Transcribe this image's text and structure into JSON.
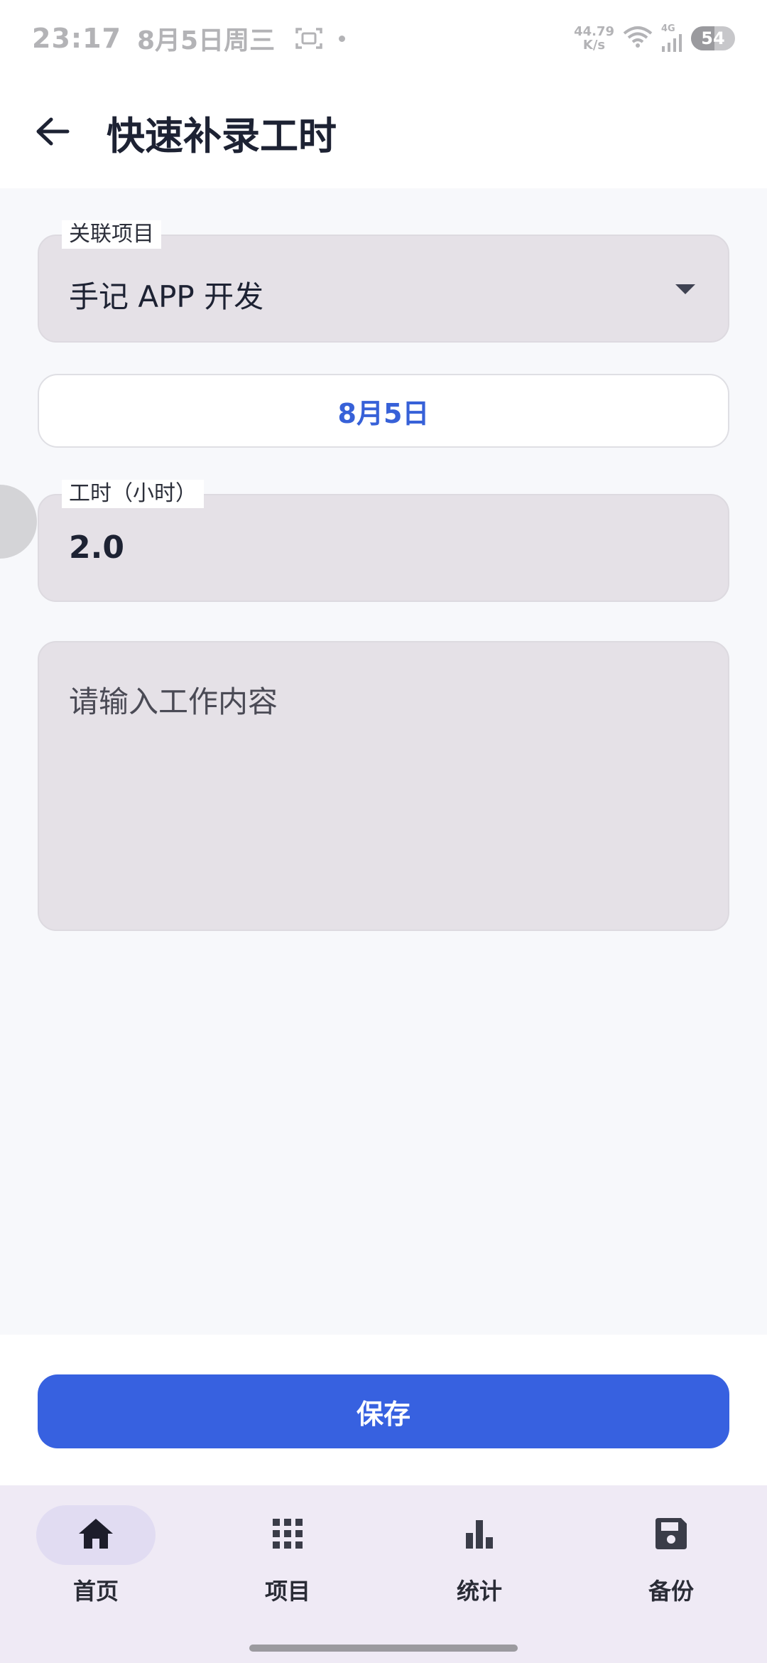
{
  "status_bar": {
    "time": "23:17",
    "date": "8月5日周三",
    "net_speed_value": "44.79",
    "net_speed_unit": "K/s",
    "network_type": "4G",
    "battery_level": "54"
  },
  "app_bar": {
    "title": "快速补录工时"
  },
  "form": {
    "project": {
      "label": "关联项目",
      "value": "手记 APP 开发"
    },
    "date": {
      "value": "8月5日"
    },
    "hours": {
      "label": "工时（小时）",
      "value": "2.0"
    },
    "content": {
      "placeholder": "请输入工作内容"
    }
  },
  "save_label": "保存",
  "bottom_nav": {
    "items": [
      {
        "label": "首页",
        "icon": "home-icon",
        "active": true
      },
      {
        "label": "项目",
        "icon": "grid-icon",
        "active": false
      },
      {
        "label": "统计",
        "icon": "bar-chart-icon",
        "active": false
      },
      {
        "label": "备份",
        "icon": "save-icon",
        "active": false
      }
    ]
  },
  "colors": {
    "accent": "#3761e0",
    "field_bg": "#e5e1e7",
    "nav_bg": "#efeaf5",
    "nav_active_bg": "#e1dcf2"
  }
}
